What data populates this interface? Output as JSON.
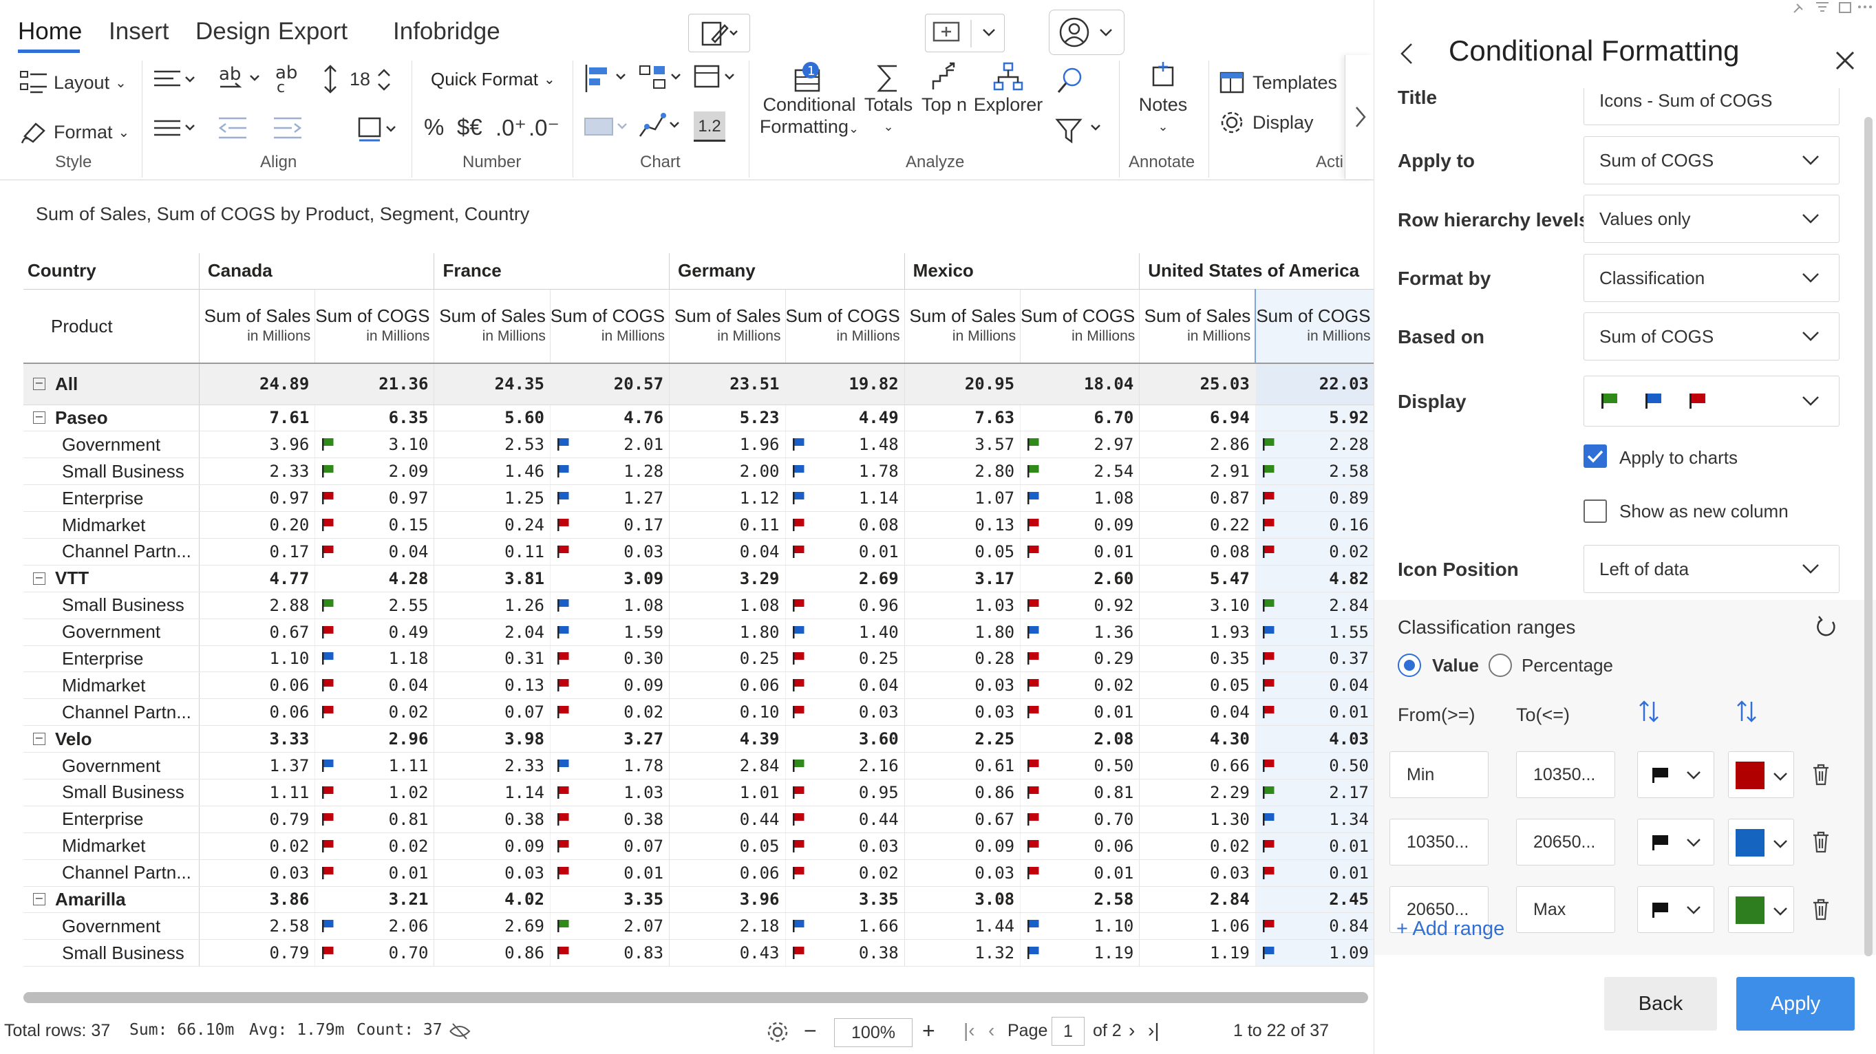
{
  "ribbon": {
    "tabs": [
      "Home",
      "Insert",
      "Design",
      "Export",
      "Infobridge"
    ],
    "style": {
      "layout": "Layout",
      "format": "Format",
      "group": "Style"
    },
    "align": {
      "group": "Align",
      "font_size": "18"
    },
    "number": {
      "quick_format": "Quick Format",
      "percent": "%",
      "currency": "$€",
      "inc_decimal": ".0⁺",
      "dec_decimal": ".0⁻",
      "group": "Number"
    },
    "chart": {
      "value_label": "1.2",
      "group": "Chart"
    },
    "analyze": {
      "conditional_formatting": "Conditional Formatting",
      "conditional_line1": "Conditional",
      "conditional_line2": "Formatting",
      "totals": "Totals",
      "topn": "Top n",
      "explorer": "Explorer",
      "group": "Analyze",
      "badge": "1"
    },
    "annotate": {
      "notes": "Notes",
      "group": "Annotate"
    },
    "actions": {
      "templates": "Templates",
      "display": "Display",
      "group": "Acti"
    }
  },
  "table": {
    "subtitle": "Sum of Sales, Sum of COGS by Product, Segment, Country",
    "country_label": "Country",
    "product_label": "Product",
    "countries": [
      "Canada",
      "France",
      "Germany",
      "Mexico",
      "United States of America"
    ],
    "measure_sales": "Sum of Sales",
    "measure_cogs": "Sum of COGS",
    "unit": "in Millions",
    "rows": [
      {
        "label": "All",
        "kind": "all",
        "v": [
          "24.89",
          "21.36",
          "24.35",
          "20.57",
          "23.51",
          "19.82",
          "20.95",
          "18.04",
          "25.03",
          "22.03"
        ],
        "f": [
          "",
          "",
          "",
          "",
          ""
        ]
      },
      {
        "label": "Paseo",
        "kind": "group",
        "v": [
          "7.61",
          "6.35",
          "5.60",
          "4.76",
          "5.23",
          "4.49",
          "7.63",
          "6.70",
          "6.94",
          "5.92"
        ],
        "f": [
          "",
          "",
          "",
          "",
          ""
        ]
      },
      {
        "label": "Government",
        "kind": "item",
        "v": [
          "3.96",
          "3.10",
          "2.53",
          "2.01",
          "1.96",
          "1.48",
          "3.57",
          "2.97",
          "2.86",
          "2.28"
        ],
        "f": [
          "g",
          "b",
          "b",
          "g",
          "g"
        ]
      },
      {
        "label": "Small Business",
        "kind": "item",
        "v": [
          "2.33",
          "2.09",
          "1.46",
          "1.28",
          "2.00",
          "1.78",
          "2.80",
          "2.54",
          "2.91",
          "2.58"
        ],
        "f": [
          "g",
          "b",
          "b",
          "g",
          "g"
        ]
      },
      {
        "label": "Enterprise",
        "kind": "item",
        "v": [
          "0.97",
          "0.97",
          "1.25",
          "1.27",
          "1.12",
          "1.14",
          "1.07",
          "1.08",
          "0.87",
          "0.89"
        ],
        "f": [
          "r",
          "b",
          "b",
          "b",
          "r"
        ]
      },
      {
        "label": "Midmarket",
        "kind": "item",
        "v": [
          "0.20",
          "0.15",
          "0.24",
          "0.17",
          "0.11",
          "0.08",
          "0.13",
          "0.09",
          "0.22",
          "0.16"
        ],
        "f": [
          "r",
          "r",
          "r",
          "r",
          "r"
        ]
      },
      {
        "label": "Channel Partn...",
        "kind": "item",
        "v": [
          "0.17",
          "0.04",
          "0.11",
          "0.03",
          "0.04",
          "0.01",
          "0.05",
          "0.01",
          "0.08",
          "0.02"
        ],
        "f": [
          "r",
          "r",
          "r",
          "r",
          "r"
        ]
      },
      {
        "label": "VTT",
        "kind": "group",
        "v": [
          "4.77",
          "4.28",
          "3.81",
          "3.09",
          "3.29",
          "2.69",
          "3.17",
          "2.60",
          "5.47",
          "4.82"
        ],
        "f": [
          "",
          "",
          "",
          "",
          ""
        ]
      },
      {
        "label": "Small Business",
        "kind": "item",
        "v": [
          "2.88",
          "2.55",
          "1.26",
          "1.08",
          "1.08",
          "0.96",
          "1.03",
          "0.92",
          "3.10",
          "2.84"
        ],
        "f": [
          "g",
          "b",
          "r",
          "r",
          "g"
        ]
      },
      {
        "label": "Government",
        "kind": "item",
        "v": [
          "0.67",
          "0.49",
          "2.04",
          "1.59",
          "1.80",
          "1.40",
          "1.80",
          "1.36",
          "1.93",
          "1.55"
        ],
        "f": [
          "r",
          "b",
          "b",
          "b",
          "b"
        ]
      },
      {
        "label": "Enterprise",
        "kind": "item",
        "v": [
          "1.10",
          "1.18",
          "0.31",
          "0.30",
          "0.25",
          "0.25",
          "0.28",
          "0.29",
          "0.35",
          "0.37"
        ],
        "f": [
          "b",
          "r",
          "r",
          "r",
          "r"
        ]
      },
      {
        "label": "Midmarket",
        "kind": "item",
        "v": [
          "0.06",
          "0.04",
          "0.13",
          "0.09",
          "0.06",
          "0.04",
          "0.03",
          "0.02",
          "0.05",
          "0.04"
        ],
        "f": [
          "r",
          "r",
          "r",
          "r",
          "r"
        ]
      },
      {
        "label": "Channel Partn...",
        "kind": "item",
        "v": [
          "0.06",
          "0.02",
          "0.07",
          "0.02",
          "0.10",
          "0.03",
          "0.03",
          "0.01",
          "0.04",
          "0.01"
        ],
        "f": [
          "r",
          "r",
          "r",
          "r",
          "r"
        ]
      },
      {
        "label": "Velo",
        "kind": "group",
        "v": [
          "3.33",
          "2.96",
          "3.98",
          "3.27",
          "4.39",
          "3.60",
          "2.25",
          "2.08",
          "4.30",
          "4.03"
        ],
        "f": [
          "",
          "",
          "",
          "",
          ""
        ]
      },
      {
        "label": "Government",
        "kind": "item",
        "v": [
          "1.37",
          "1.11",
          "2.33",
          "1.78",
          "2.84",
          "2.16",
          "0.61",
          "0.50",
          "0.66",
          "0.50"
        ],
        "f": [
          "b",
          "b",
          "g",
          "r",
          "r"
        ]
      },
      {
        "label": "Small Business",
        "kind": "item",
        "v": [
          "1.11",
          "1.02",
          "1.14",
          "1.03",
          "1.01",
          "0.95",
          "0.86",
          "0.81",
          "2.29",
          "2.17"
        ],
        "f": [
          "r",
          "r",
          "r",
          "r",
          "g"
        ]
      },
      {
        "label": "Enterprise",
        "kind": "item",
        "v": [
          "0.79",
          "0.81",
          "0.38",
          "0.38",
          "0.44",
          "0.44",
          "0.67",
          "0.70",
          "1.30",
          "1.34"
        ],
        "f": [
          "r",
          "r",
          "r",
          "r",
          "b"
        ]
      },
      {
        "label": "Midmarket",
        "kind": "item",
        "v": [
          "0.02",
          "0.02",
          "0.09",
          "0.07",
          "0.05",
          "0.03",
          "0.09",
          "0.06",
          "0.02",
          "0.01"
        ],
        "f": [
          "r",
          "r",
          "r",
          "r",
          "r"
        ]
      },
      {
        "label": "Channel Partn...",
        "kind": "item",
        "v": [
          "0.03",
          "0.01",
          "0.03",
          "0.01",
          "0.06",
          "0.02",
          "0.03",
          "0.01",
          "0.03",
          "0.01"
        ],
        "f": [
          "r",
          "r",
          "r",
          "r",
          "r"
        ]
      },
      {
        "label": "Amarilla",
        "kind": "group",
        "v": [
          "3.86",
          "3.21",
          "4.02",
          "3.35",
          "3.96",
          "3.35",
          "3.08",
          "2.58",
          "2.84",
          "2.45"
        ],
        "f": [
          "",
          "",
          "",
          "",
          ""
        ]
      },
      {
        "label": "Government",
        "kind": "item",
        "v": [
          "2.58",
          "2.06",
          "2.69",
          "2.07",
          "2.18",
          "1.66",
          "1.44",
          "1.10",
          "1.06",
          "0.84"
        ],
        "f": [
          "b",
          "g",
          "b",
          "b",
          "r"
        ]
      },
      {
        "label": "Small Business",
        "kind": "item",
        "v": [
          "0.79",
          "0.70",
          "0.86",
          "0.83",
          "0.43",
          "0.38",
          "1.32",
          "1.19",
          "1.19",
          "1.09"
        ],
        "f": [
          "r",
          "r",
          "r",
          "b",
          "b"
        ]
      }
    ]
  },
  "status": {
    "total_rows": "Total rows: 37",
    "sum": "Sum: 66.10m",
    "avg": "Avg: 1.79m",
    "count": "Count: 37",
    "zoom": "100%",
    "page_label": "Page",
    "page_value": "1",
    "page_of": "of 2",
    "range": "1 to 22 of 37"
  },
  "panel": {
    "title": "Conditional Formatting",
    "fields": {
      "title_label": "Title",
      "title_value": "Icons - Sum of COGS",
      "apply_to_label": "Apply to",
      "apply_to_value": "Sum of COGS",
      "row_levels_label": "Row hierarchy levels",
      "row_levels_value": "Values only",
      "format_by_label": "Format by",
      "format_by_value": "Classification",
      "based_on_label": "Based on",
      "based_on_value": "Sum of COGS",
      "display_label": "Display",
      "apply_charts": "Apply to charts",
      "new_column": "Show as new column",
      "icon_position_label": "Icon Position",
      "icon_position_value": "Left of data"
    },
    "ranges": {
      "heading": "Classification ranges",
      "value_opt": "Value",
      "percentage_opt": "Percentage",
      "from_label": "From(>=)",
      "to_label": "To(<=)",
      "items": [
        {
          "from": "Min",
          "to": "10350...",
          "color": "#b00000"
        },
        {
          "from": "10350...",
          "to": "20650...",
          "color": "#1565c0"
        },
        {
          "from": "20650...",
          "to": "Max",
          "color": "#2e7d1e"
        }
      ],
      "add_range": "+ Add range"
    },
    "back": "Back",
    "apply": "Apply"
  },
  "colors": {
    "flag_green": "#2f8a1a",
    "flag_blue": "#1a5fc8",
    "flag_red": "#c0000b",
    "accent": "#2f6fd6",
    "apply_btn": "#3d8ee8"
  }
}
